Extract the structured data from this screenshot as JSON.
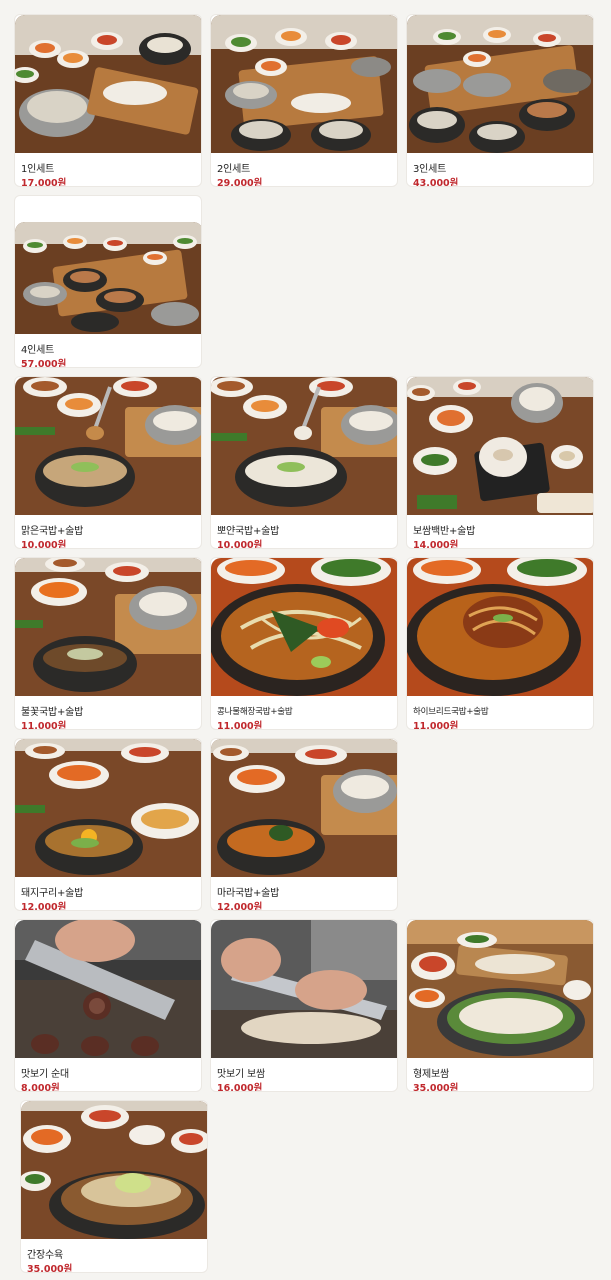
{
  "menu": {
    "items": [
      {
        "name": "1인세트",
        "price": "17,000원",
        "icon": "set-meal-photo"
      },
      {
        "name": "2인세트",
        "price": "29,000원",
        "icon": "set-meal-photo"
      },
      {
        "name": "3인세트",
        "price": "43,000원",
        "icon": "set-meal-photo"
      },
      {
        "name": "4인세트",
        "price": "57,000원",
        "icon": "set-meal-photo"
      },
      {
        "name": "맑은국밥+술밥",
        "price": "10,000원",
        "icon": "gukbap-photo"
      },
      {
        "name": "뽀얀국밥+술밥",
        "price": "10,000원",
        "icon": "gukbap-photo"
      },
      {
        "name": "보쌈백반+술밥",
        "price": "14,000원",
        "icon": "bossam-photo"
      },
      {
        "name": "불꽃국밥+술밥",
        "price": "11,000원",
        "icon": "gukbap-photo"
      },
      {
        "name": "콩나물해장국밥+술밥",
        "price": "11,000원",
        "icon": "haejangguk-photo"
      },
      {
        "name": "하이브리드국밥+술밥",
        "price": "11,000원",
        "icon": "haejangguk-photo"
      },
      {
        "name": "돼지구리+술밥",
        "price": "12,000원",
        "icon": "gukbap-photo"
      },
      {
        "name": "마라국밥+술밥",
        "price": "12,000원",
        "icon": "gukbap-photo"
      },
      {
        "name": "맛보기 순대",
        "price": "8,000원",
        "icon": "sundae-photo"
      },
      {
        "name": "맛보기 보쌈",
        "price": "16,000원",
        "icon": "bossam-slice-photo"
      },
      {
        "name": "형제보쌈",
        "price": "35,000원",
        "icon": "bossam-platter-photo"
      },
      {
        "name": "간장수육",
        "price": "35,000원",
        "icon": "suyuk-photo"
      }
    ]
  },
  "colors": {
    "background": "#f5f4f1",
    "price": "#c0282d",
    "name": "#222222",
    "card": "#ffffff"
  }
}
